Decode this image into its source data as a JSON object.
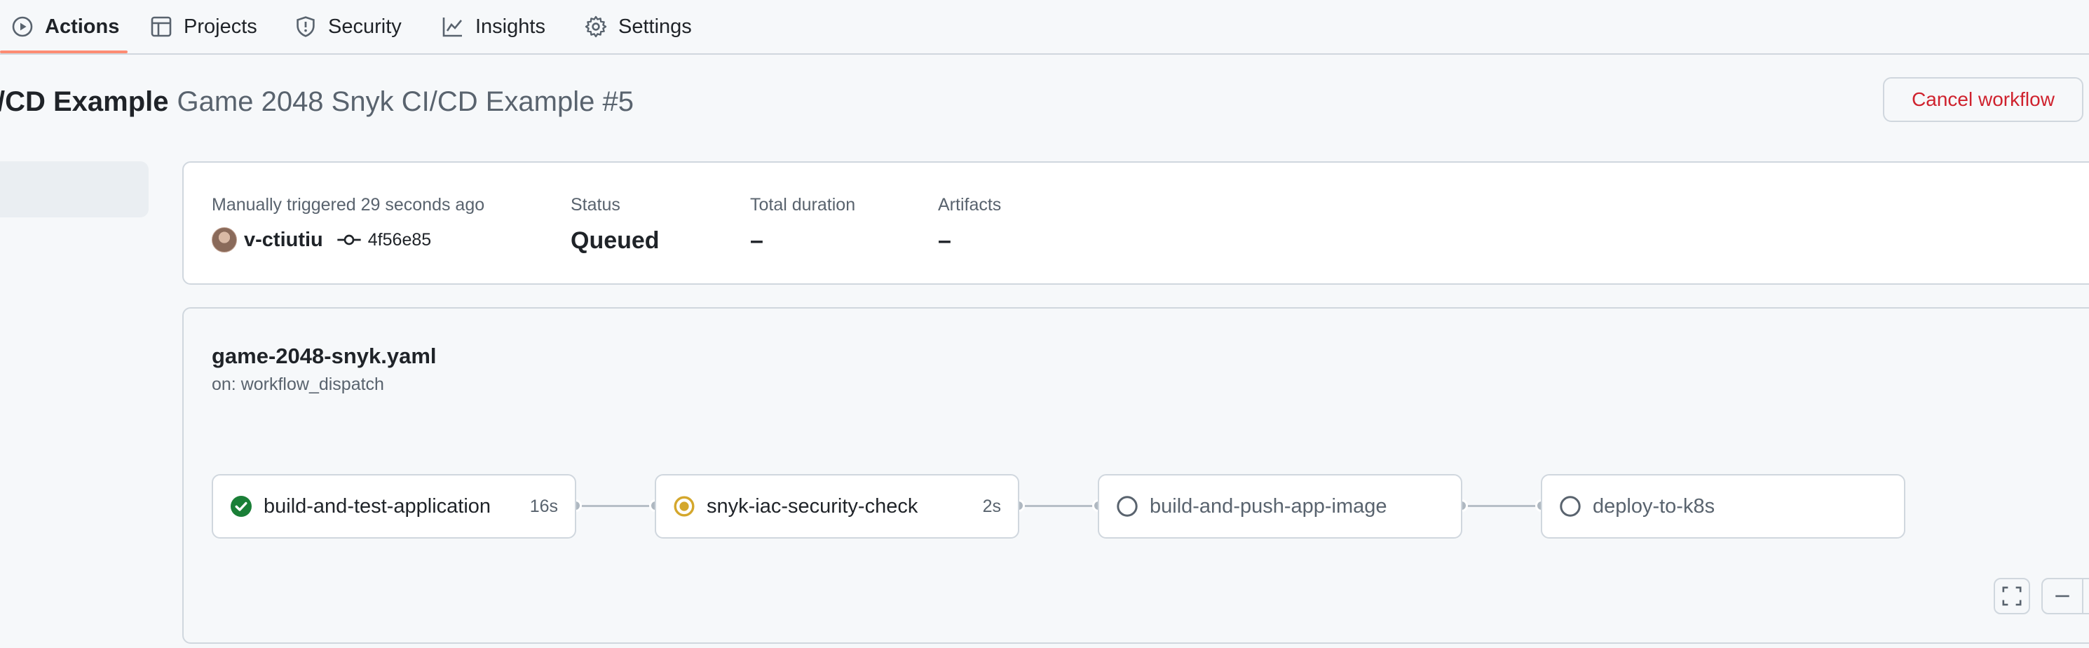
{
  "nav": {
    "tabs": [
      {
        "label": "Actions",
        "icon": "play-icon",
        "active": true
      },
      {
        "label": "Projects",
        "icon": "table-icon"
      },
      {
        "label": "Security",
        "icon": "shield-icon"
      },
      {
        "label": "Insights",
        "icon": "graph-icon"
      },
      {
        "label": "Settings",
        "icon": "gear-icon"
      }
    ]
  },
  "header": {
    "workflow_title": "/CD Example",
    "run_title": "Game 2048 Snyk CI/CD Example #5",
    "cancel_label": "Cancel workflow"
  },
  "summary": {
    "trigger_text": "Manually triggered 29 seconds ago",
    "actor": "v-ctiutiu",
    "commit": "4f56e85",
    "status_label": "Status",
    "status_value": "Queued",
    "duration_label": "Total duration",
    "duration_value": "–",
    "artifacts_label": "Artifacts",
    "artifacts_value": "–"
  },
  "workflow": {
    "file": "game-2048-snyk.yaml",
    "trigger": "on: workflow_dispatch",
    "jobs": [
      {
        "name": "build-and-test-application",
        "duration": "16s",
        "status": "success"
      },
      {
        "name": "snyk-iac-security-check",
        "duration": "2s",
        "status": "in-progress"
      },
      {
        "name": "build-and-push-app-image",
        "duration": "",
        "status": "pending"
      },
      {
        "name": "deploy-to-k8s",
        "duration": "",
        "status": "pending"
      }
    ]
  },
  "colors": {
    "accent_underline": "#fd8c73",
    "danger": "#cf222e",
    "success": "#1a7f37",
    "in_progress": "#d4a72c",
    "muted": "#59636e"
  }
}
